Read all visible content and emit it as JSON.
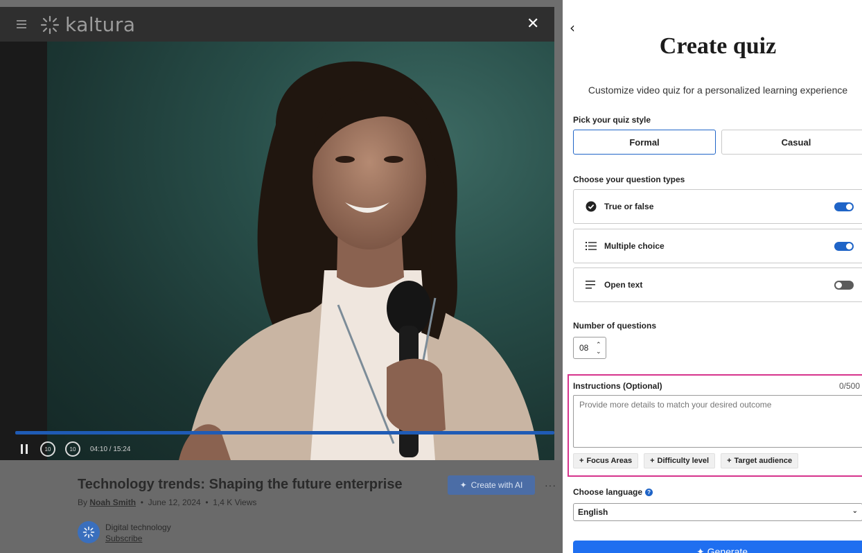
{
  "player": {
    "logo_text": "kaltura",
    "time_display": "04:10 / 15:24",
    "skip_back_label": "10",
    "skip_forward_label": "10",
    "progress_fraction": 1.0
  },
  "video": {
    "title": "Technology trends: Shaping the future enterprise",
    "by_prefix": "By",
    "author": "Noah Smith",
    "date": "June 12, 2024",
    "views": "1,4 K Views",
    "create_ai_label": "Create with AI",
    "channel_name": "Digital technology",
    "subscribe_label": "Subscribe"
  },
  "quiz": {
    "title": "Create quiz",
    "subtitle": "Customize video quiz for a personalized learning experience",
    "style_label": "Pick your quiz style",
    "styles": [
      {
        "label": "Formal",
        "selected": true
      },
      {
        "label": "Casual",
        "selected": false
      }
    ],
    "types_label": "Choose your question types",
    "question_types": [
      {
        "label": "True or false",
        "icon": "check-circle-icon",
        "enabled": true
      },
      {
        "label": "Multiple choice",
        "icon": "list-icon",
        "enabled": true
      },
      {
        "label": "Open text",
        "icon": "text-lines-icon",
        "enabled": false
      }
    ],
    "num_questions_label": "Number of questions",
    "num_questions_value": "08",
    "instructions_label": "Instructions (Optional)",
    "instructions_count": "0/500",
    "instructions_placeholder": "Provide more details to match your desired outcome",
    "chips": [
      "Focus Areas",
      "Difficulty level",
      "Target audience"
    ],
    "language_label": "Choose language",
    "language_value": "English",
    "generate_label": "Generate"
  },
  "colors": {
    "accent": "#1f64c7",
    "highlight_border": "#d6338c",
    "overlay": "#6a6a6a"
  }
}
